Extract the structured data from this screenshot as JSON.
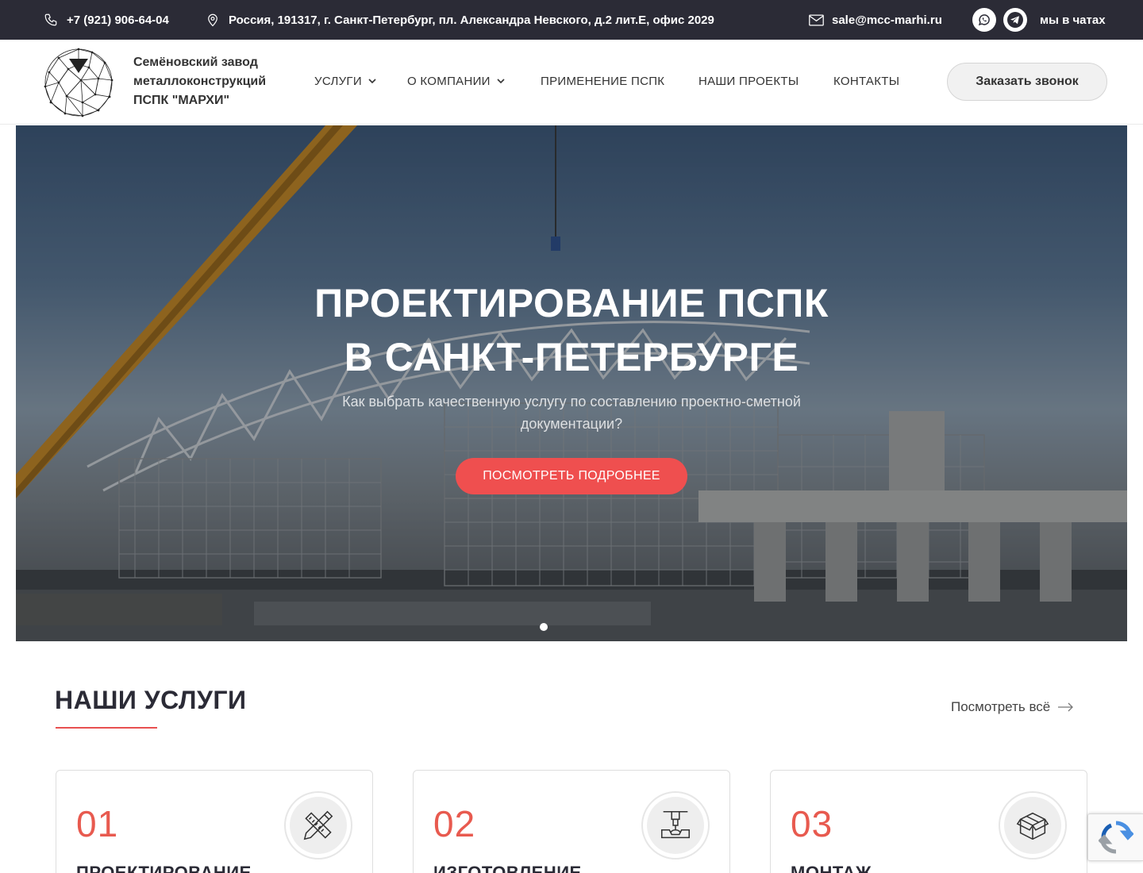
{
  "topbar": {
    "phone": "+7 (921) 906-64-04",
    "address": "Россия, 191317, г. Санкт-Петербург, пл. Александра Невского, д.2 лит.Е, офис 2029",
    "email": "sale@mcc-marhi.ru",
    "chats_label": "мы в чатах",
    "icons": [
      "phone-icon",
      "location-pin-icon",
      "mail-icon",
      "whatsapp-icon",
      "telegram-icon"
    ]
  },
  "header": {
    "brand_line1": "Семёновский завод",
    "brand_line2": "металлоконструкций",
    "brand_line3": "ПСПК \"МАРХИ\"",
    "nav": [
      {
        "label": "УСЛУГИ",
        "has_dropdown": true
      },
      {
        "label": "О КОМПАНИИ",
        "has_dropdown": true
      },
      {
        "label": "ПРИМЕНЕНИЕ ПСПК",
        "has_dropdown": false
      },
      {
        "label": "НАШИ ПРОЕКТЫ",
        "has_dropdown": false
      },
      {
        "label": "КОНТАКТЫ",
        "has_dropdown": false
      }
    ],
    "call_button": "Заказать звонок"
  },
  "hero": {
    "title_line1": "ПРОЕКТИРОВАНИЕ ПСПК",
    "title_line2": "В САНКТ-ПЕТЕРБУРГЕ",
    "subtitle": "Как выбрать качественную услугу по составлению проектно-сметной документации?",
    "cta": "ПОСМОТРЕТЬ ПОДРОБНЕЕ",
    "slides_total": 1,
    "active_slide": 1
  },
  "services": {
    "title": "НАШИ УСЛУГИ",
    "view_all": "Посмотреть всё",
    "cards": [
      {
        "num": "01",
        "name": "ПРОЕКТИРОВАНИЕ",
        "icon": "ruler-pencil-icon"
      },
      {
        "num": "02",
        "name": "ИЗГОТОВЛЕНИЕ",
        "icon": "press-machine-icon"
      },
      {
        "num": "03",
        "name": "МОНТАЖ",
        "icon": "box-icon"
      }
    ]
  },
  "colors": {
    "topbar_bg": "#2b2b36",
    "accent": "#ef4f4f",
    "number_red": "#e85a4f",
    "heading_dark": "#2b2b36"
  }
}
